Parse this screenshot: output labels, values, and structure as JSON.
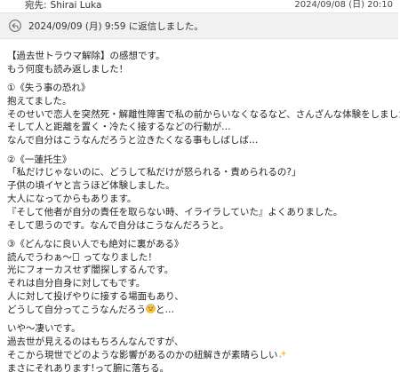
{
  "header": {
    "to_label": "宛先:",
    "to_name": "Shirai Luka",
    "date": "2024/09/08 (日) 20:10"
  },
  "reply_notice": {
    "icon": "reply-arrow-icon",
    "text": "2024/09/09 (月) 9:59 に返信しました。"
  },
  "message": {
    "p1": [
      "【過去世トラウマ解除】の感想です。",
      "もう何度も読み返しました！"
    ],
    "p2": [
      "①《失う事の恐れ》",
      "抱えてました。",
      "そのせいで恋人を突然死・解離性障害で私の前からいなくなるなど、さんざんな体験をしました。",
      "そして人と距離を置く・冷たく接するなどの行動が…",
      "なんで自分はこうなんだろうと泣きたくなる事もしばしば…"
    ],
    "p3": [
      "②《一蓮托生》",
      "「私だけじゃないのに、どうして私だけが怒られる・責められるの?」",
      "子供の頃イヤと言うほど体験しました。",
      "大人になってからもあります。",
      "『そして他者が自分の責任を取らない時、イライラしていた』よくありました。",
      "そして思うのです。なんで自分はこうなんだろうと。"
    ],
    "p4": [
      "③《どんなに良い人でも絶対に裏がある》",
      "読んでうわぁ〜",
      " ってなりました！",
      "光にフォーカスせず闇探しするんです。",
      "それは自分自身に対してもです。",
      "人に対して投げやりに接する場面もあり、",
      "どうして自分ってこうなんだろう",
      "と…"
    ],
    "p5": [
      "いや〜凄いです。",
      "過去世が見えるのはもちろんなんですが、",
      "そこから現世でどのような影響があるのかの紐解きが素晴らしい",
      "まさにそれあります!って腑に落ちる。"
    ]
  }
}
